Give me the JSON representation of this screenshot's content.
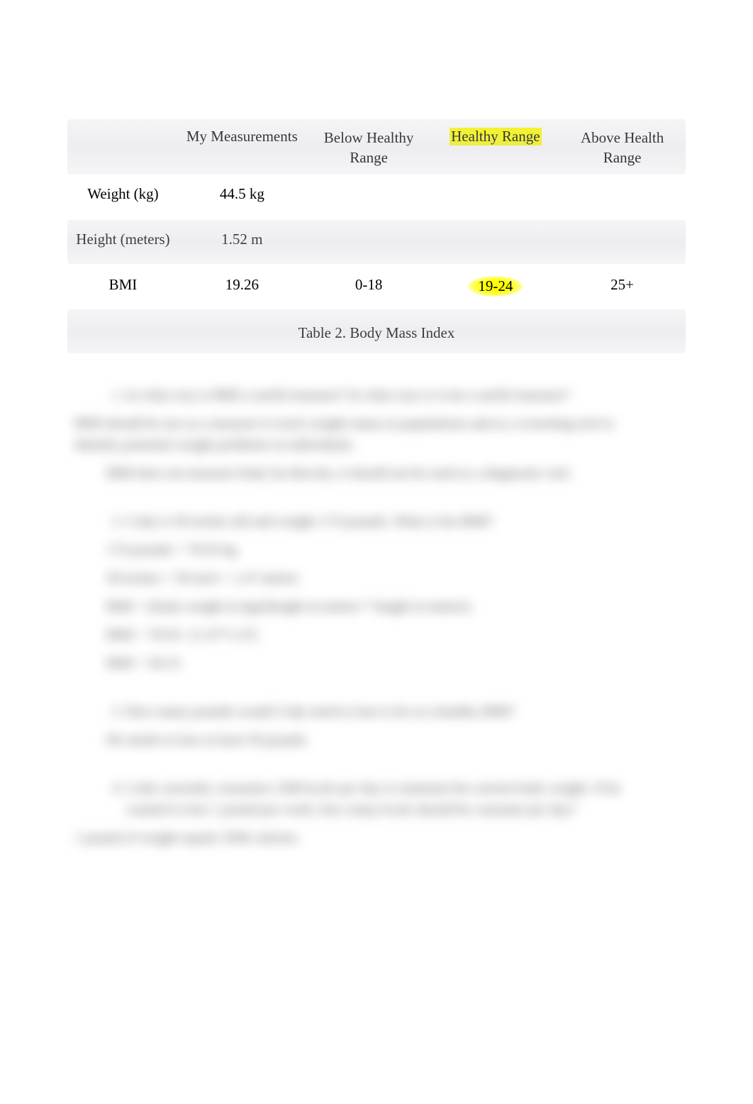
{
  "table": {
    "headers": {
      "blank": "",
      "my_measurements": "My Measurements",
      "below_healthy": "Below Healthy Range",
      "healthy": "Healthy Range",
      "above_healthy": "Above Health Range"
    },
    "rows": [
      {
        "label": "Weight (kg)",
        "my": "44.5 kg",
        "below": "",
        "healthy": "",
        "above": ""
      },
      {
        "label": "Height (meters)",
        "my": "1.52 m",
        "below": "",
        "healthy": "",
        "above": ""
      },
      {
        "label": "BMI",
        "my": "19.26",
        "below": "0-18",
        "healthy": "19-24",
        "above": "25+"
      }
    ]
  },
  "caption": "Table 2. Body Mass Index",
  "blurred": {
    "q1": "In what way is BMI a useful measure? In what way is it not a useful measure?",
    "q1_a1": "BMI should be use as a measure to track weight status in populations and as a screening tool to identify potential weight problems in individuals.",
    "q1_a2": "BMI does not measure body fat directly, it should not be used as a diagnostic tool.",
    "q2": "Cody is 58 inches tall and weighs 174 pounds. What is his BMI?",
    "q2_l1": "174 pounds = 78.93 kg",
    "q2_l2": "58 inches = 58 inch = 1.47 meters",
    "q2_l3": "BMI = (body weight in kg)/(height in meters * height in meters)",
    "q2_l4": "BMI = 78.93 / (1.47*1.47)",
    "q2_l5": "BMI = 36.53",
    "q3": "How many pounds would Cody need to lose to be at a healthy BMI?",
    "q3_a": "He needs to lose at least 59 pounds.",
    "q4": "Cody currently consumes 2300 kcals per day to maintain his current body weight. If he wanted to lose 1 pound per week, how many kcals should he consume per day?",
    "q4_a": "1 pound of weight equals 3500 calories."
  }
}
